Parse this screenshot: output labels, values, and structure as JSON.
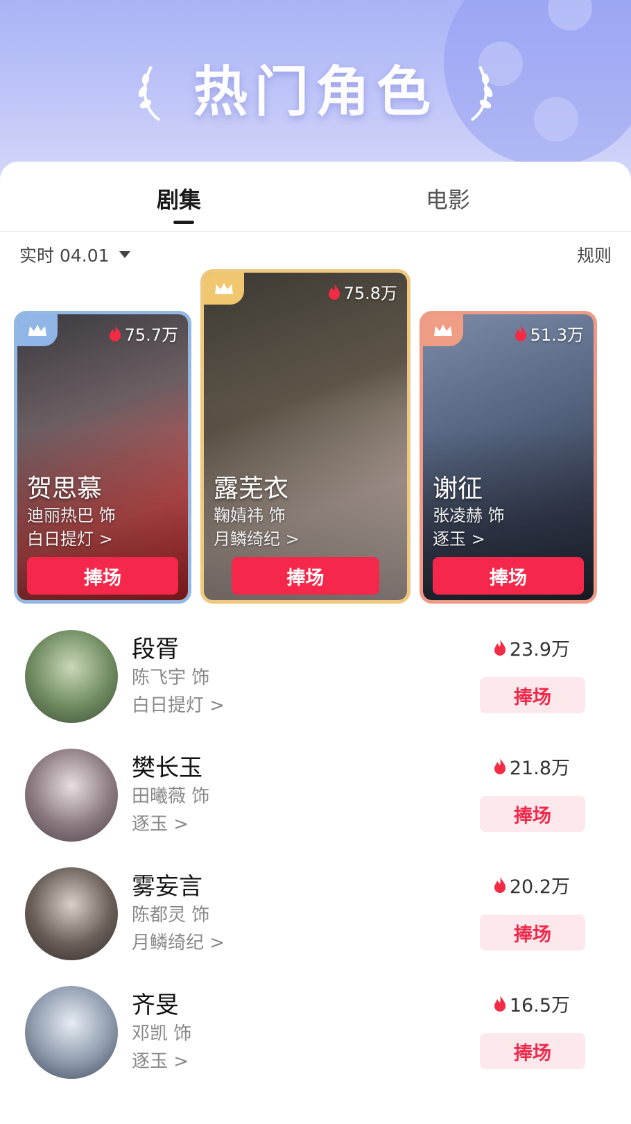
{
  "header": {
    "title": "热门角色"
  },
  "tabs": [
    {
      "label": "剧集",
      "active": true
    },
    {
      "label": "电影",
      "active": false
    }
  ],
  "filter": {
    "label": "实时 04.01",
    "rules_label": "规则"
  },
  "colors": {
    "accent": "#f5274a",
    "accent_soft": "#fde8ec",
    "flame": "#f32b45"
  },
  "top3": [
    {
      "rank": 2,
      "role": "贺思慕",
      "actor": "迪丽热巴 饰",
      "drama": "白日提灯 >",
      "heat": "75.7万",
      "button": "捧场",
      "crown_color": "#8fb6e6"
    },
    {
      "rank": 1,
      "role": "露芜衣",
      "actor": "鞠婧祎 饰",
      "drama": "月鳞绮纪 >",
      "heat": "75.8万",
      "button": "捧场",
      "crown_color": "#f0c76f"
    },
    {
      "rank": 3,
      "role": "谢征",
      "actor": "张凌赫 饰",
      "drama": "逐玉 >",
      "heat": "51.3万",
      "button": "捧场",
      "crown_color": "#ef9d84"
    }
  ],
  "list": [
    {
      "role": "段胥",
      "actor": "陈飞宇 饰",
      "drama": "白日提灯 >",
      "heat": "23.9万",
      "button": "捧场"
    },
    {
      "role": "樊长玉",
      "actor": "田曦薇 饰",
      "drama": "逐玉 >",
      "heat": "21.8万",
      "button": "捧场"
    },
    {
      "role": "雾妄言",
      "actor": "陈都灵 饰",
      "drama": "月鳞绮纪 >",
      "heat": "20.2万",
      "button": "捧场"
    },
    {
      "role": "齐旻",
      "actor": "邓凯 饰",
      "drama": "逐玉 >",
      "heat": "16.5万",
      "button": "捧场"
    }
  ]
}
